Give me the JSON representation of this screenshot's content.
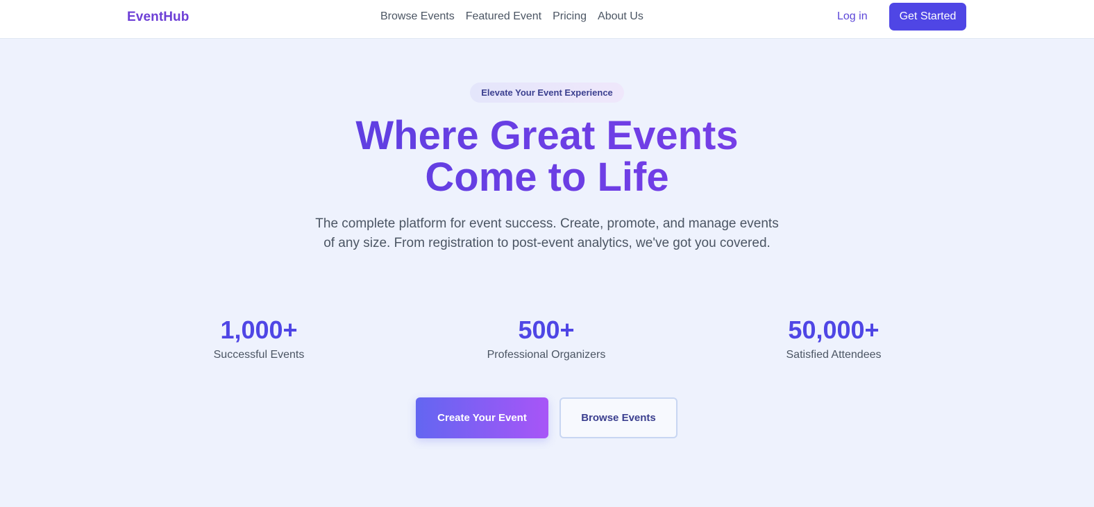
{
  "navbar": {
    "logo": "EventHub",
    "links": [
      "Browse Events",
      "Featured Event",
      "Pricing",
      "About Us"
    ],
    "login_label": "Log in",
    "cta_label": "Get Started"
  },
  "hero": {
    "badge": "Elevate Your Event Experience",
    "title_line1": "Where Great Events",
    "title_line2": "Come to Life",
    "subtitle": "The complete platform for event success. Create, promote, and manage events of any size. From registration to post-event analytics, we've got you covered.",
    "stats": [
      {
        "value": "1,000+",
        "label": "Successful Events"
      },
      {
        "value": "500+",
        "label": "Professional Organizers"
      },
      {
        "value": "50,000+",
        "label": "Satisfied Attendees"
      }
    ],
    "primary_button": "Create Your Event",
    "secondary_button": "Browse Events"
  },
  "colors": {
    "background": "#eef2fd",
    "accent": "#4f46e5",
    "accent_purple": "#a855f7",
    "logo": "#6d3fd6"
  }
}
